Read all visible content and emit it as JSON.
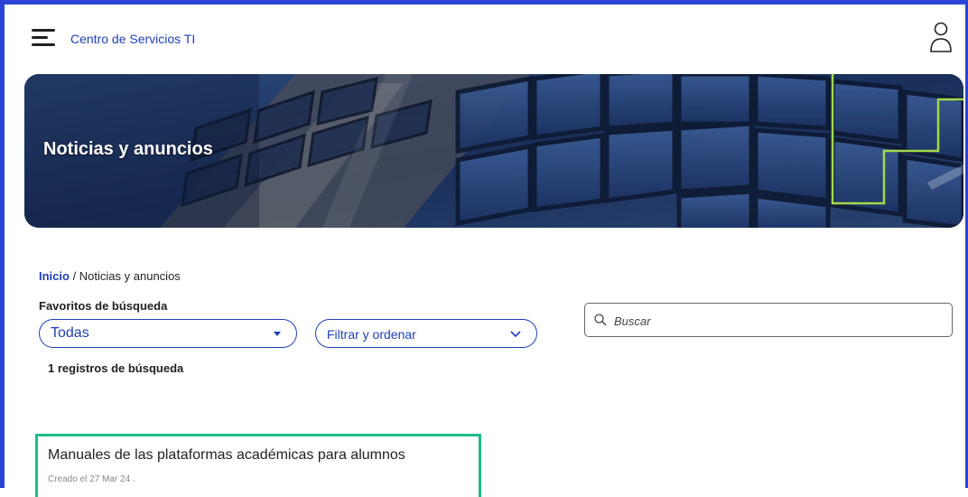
{
  "header": {
    "site_title": "Centro de Servicios TI"
  },
  "banner": {
    "title": "Noticias y anuncios"
  },
  "breadcrumb": {
    "home": "Inicio",
    "separator": " / ",
    "current": "Noticias y anuncios"
  },
  "filters": {
    "favorites_label": "Favoritos de búsqueda",
    "favorites_selected": "Todas",
    "filter_sort_label": "Filtrar y ordenar"
  },
  "search": {
    "placeholder": "Buscar"
  },
  "results": {
    "count_text": "1 registros de búsqueda",
    "items": [
      {
        "title": "Manuales de las plataformas académicas para alumnos",
        "meta": "Creado el 27 Mar 24 ."
      }
    ]
  },
  "colors": {
    "frame_border": "#2b44d6",
    "brand_blue": "#1f3fb5",
    "card_highlight": "#1fba8a",
    "banner_accent": "#a3d94a"
  },
  "icons": {
    "menu": "hamburger-menu-icon",
    "user": "user-profile-icon",
    "search": "search-icon",
    "dropdown": "chevron-down-icon"
  }
}
